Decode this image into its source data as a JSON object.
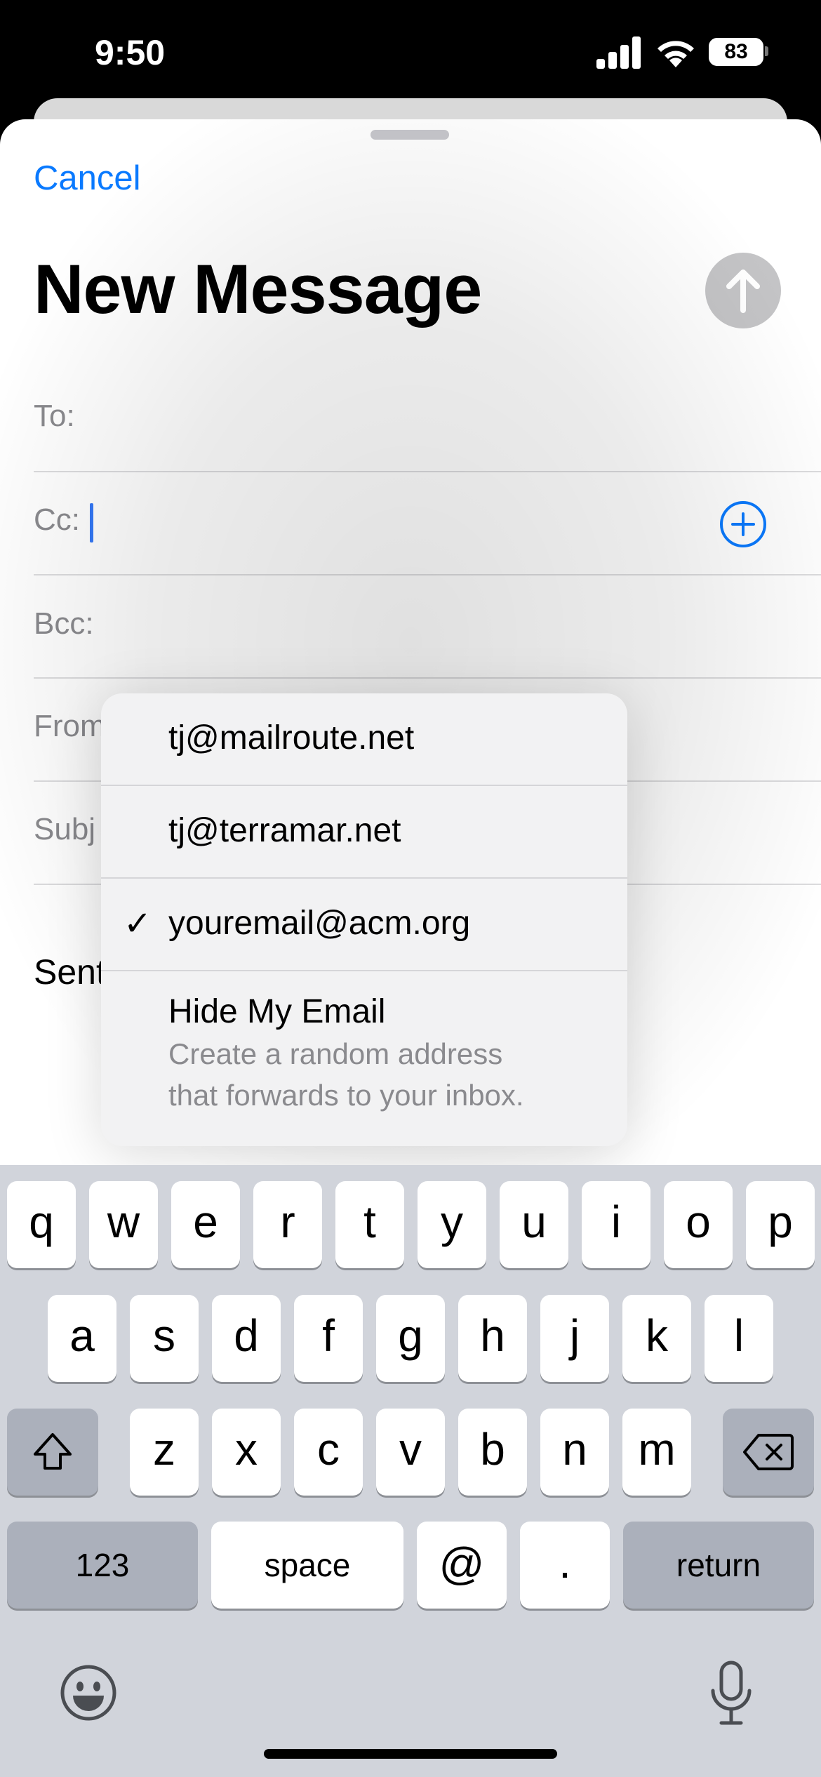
{
  "status": {
    "time": "9:50",
    "battery": "83"
  },
  "header": {
    "cancel_label": "Cancel",
    "title": "New Message"
  },
  "fields": {
    "to_label": "To:",
    "cc_label": "Cc:",
    "bcc_label": "Bcc:",
    "from_label_partial": "From",
    "subject_label_partial": "Subj",
    "body_partial": "Sent"
  },
  "from_menu": {
    "options": [
      {
        "label": "tj@mailroute.net",
        "selected": false
      },
      {
        "label": "tj@terramar.net",
        "selected": false
      },
      {
        "label": "youremail@acm.org",
        "selected": true
      }
    ],
    "check_glyph": "✓",
    "hide_my_email": {
      "label": "Hide My Email",
      "description_line1": "Create a random address",
      "description_line2": "that forwards to your inbox."
    }
  },
  "keyboard": {
    "row1": [
      "q",
      "w",
      "e",
      "r",
      "t",
      "y",
      "u",
      "i",
      "o",
      "p"
    ],
    "row2": [
      "a",
      "s",
      "d",
      "f",
      "g",
      "h",
      "j",
      "k",
      "l"
    ],
    "row3": [
      "z",
      "x",
      "c",
      "v",
      "b",
      "n",
      "m"
    ],
    "numbers_label": "123",
    "space_label": "space",
    "at_label": "@",
    "dot_label": ".",
    "return_label": "return"
  },
  "icons": {
    "send": "arrow-up-icon",
    "add_contact": "plus-circle-icon",
    "shift": "shift-icon",
    "delete": "backspace-icon",
    "emoji": "emoji-icon",
    "mic": "microphone-icon"
  },
  "colors": {
    "accent": "#0a7aff",
    "caret": "#3478f6",
    "send_disabled": "#c4c4c6"
  }
}
